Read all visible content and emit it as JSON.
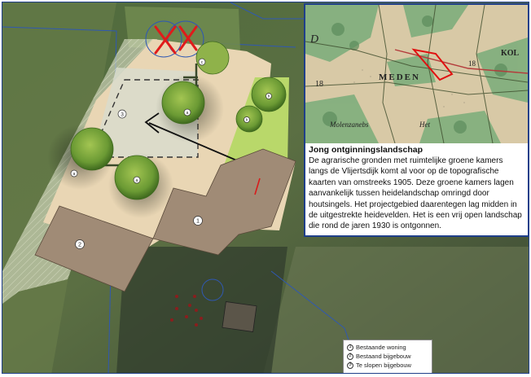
{
  "site_plan": {
    "markers": [
      "1",
      "2",
      "3",
      "a",
      "a",
      "a",
      "b",
      "b",
      "c"
    ]
  },
  "inset": {
    "map_labels": [
      "D",
      "KOL",
      "18",
      "18",
      "MEDEN",
      "Molenzanebs",
      "Het"
    ],
    "title": "Jong ontginningslandschap",
    "body": "De agrarische gronden met ruimtelijke groene kamers langs de Vlijertsdijk komt al voor op de topografische kaarten van omstreeks 1905. Deze groene kamers lagen aanvankelijk tussen heidelandschap omringd door houtsingels. Het projectgebied daarentegen lag midden in de uitgestrekte heidevelden. Het is een vrij open landschap die rond de jaren 1930 is ontgonnen."
  },
  "legend": {
    "items": [
      {
        "num": "1",
        "label": "Bestaande woning"
      },
      {
        "num": "2",
        "label": "Bestaand bijgebouw"
      },
      {
        "num": "3",
        "label": "Te slopen bijgebouw"
      }
    ]
  },
  "colors": {
    "frame": "#1f3f8a",
    "demolish_cross": "#e01b1b",
    "inset_outline": "#e01010",
    "plot_fill": "#e9d6b4",
    "building_fill": "#a08b76",
    "grass_fill": "#b9d86a"
  }
}
